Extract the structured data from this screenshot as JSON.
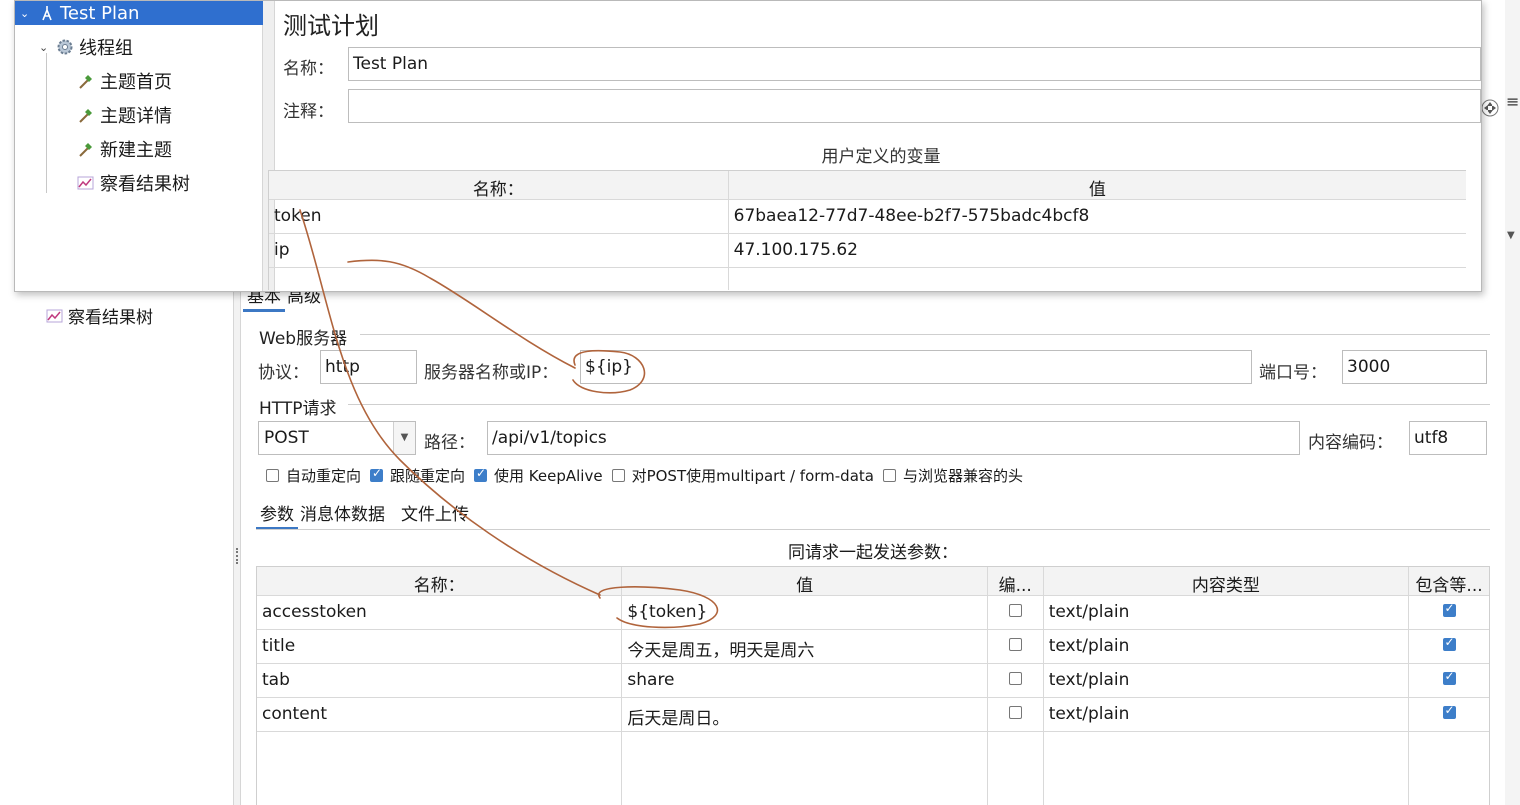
{
  "popup": {
    "tree": {
      "root": "Test Plan",
      "thread_group": "线程组",
      "samplers": [
        "主题首页",
        "主题详情",
        "新建主题"
      ],
      "listener": "察看结果树"
    },
    "title": "测试计划",
    "name_label": "名称：",
    "name_value": "Test Plan",
    "comment_label": "注释：",
    "comment_value": "",
    "variables": {
      "caption": "用户定义的变量",
      "headers": [
        "名称：",
        "值"
      ],
      "rows": [
        {
          "name": "token",
          "value": "67baea12-77d7-48ee-b2f7-575badc4bcf8"
        },
        {
          "name": "ip",
          "value": "47.100.175.62"
        }
      ]
    }
  },
  "background": {
    "tree_item": "察看结果树",
    "tabs": [
      "基本",
      "高级"
    ],
    "web_server": {
      "title": "Web服务器",
      "protocol_label": "协议：",
      "protocol": "http",
      "server_label": "服务器名称或IP：",
      "server": "${ip}",
      "port_label": "端口号：",
      "port": "3000"
    },
    "http_request": {
      "title": "HTTP请求",
      "method": "POST",
      "path_label": "路径：",
      "path": "/api/v1/topics",
      "encoding_label": "内容编码：",
      "encoding": "utf8"
    },
    "options": [
      {
        "label": "自动重定向",
        "checked": false
      },
      {
        "label": "跟随重定向",
        "checked": true
      },
      {
        "label": "使用 KeepAlive",
        "checked": true
      },
      {
        "label": "对POST使用multipart / form-data",
        "checked": false
      },
      {
        "label": "与浏览器兼容的头",
        "checked": false
      }
    ],
    "param_tabs": [
      "参数",
      "消息体数据",
      "文件上传"
    ],
    "params": {
      "caption": "同请求一起发送参数：",
      "headers": [
        "名称：",
        "值",
        "编...",
        "内容类型",
        "包含等..."
      ],
      "rows": [
        {
          "name": "accesstoken",
          "value": "${token}",
          "encode": false,
          "type": "text/plain",
          "include_equals": true
        },
        {
          "name": "title",
          "value": "今天是周五，明天是周六",
          "encode": false,
          "type": "text/plain",
          "include_equals": true
        },
        {
          "name": "tab",
          "value": "share",
          "encode": false,
          "type": "text/plain",
          "include_equals": true
        },
        {
          "name": "content",
          "value": "后天是周日。",
          "encode": false,
          "type": "text/plain",
          "include_equals": true
        }
      ]
    }
  },
  "colors": {
    "selection": "#2f6fcf",
    "checkbox": "#3d7ec9",
    "tab_underline": "#3c78c4",
    "annotation": "#b0643c"
  }
}
